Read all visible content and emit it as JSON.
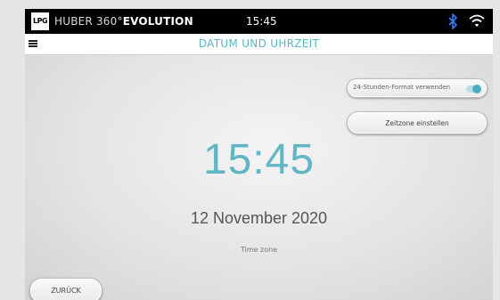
{
  "statusbar": {
    "logo_text": "LPG",
    "brand_prefix": "HUBER 360°",
    "brand_suffix": "EVOLUTION",
    "time": "15:45",
    "bluetooth_icon": "bluetooth-icon",
    "wifi_icon": "wifi-icon"
  },
  "titlebar": {
    "menu_icon": "menu-icon",
    "title": "DATUM UND UHRZEIT"
  },
  "settings": {
    "format_label": "24-Stunden-Format verwenden",
    "format_enabled": true,
    "timezone_button": "Zeitzone einstellen"
  },
  "main": {
    "time": "15:45",
    "date": "12 November 2020",
    "timezone_label": "Time zone"
  },
  "footer": {
    "back_label": "ZURÜCK"
  },
  "colors": {
    "accent": "#5ab7c6",
    "statusbar_bg": "#000000",
    "toggle_on": "#48aebe"
  }
}
